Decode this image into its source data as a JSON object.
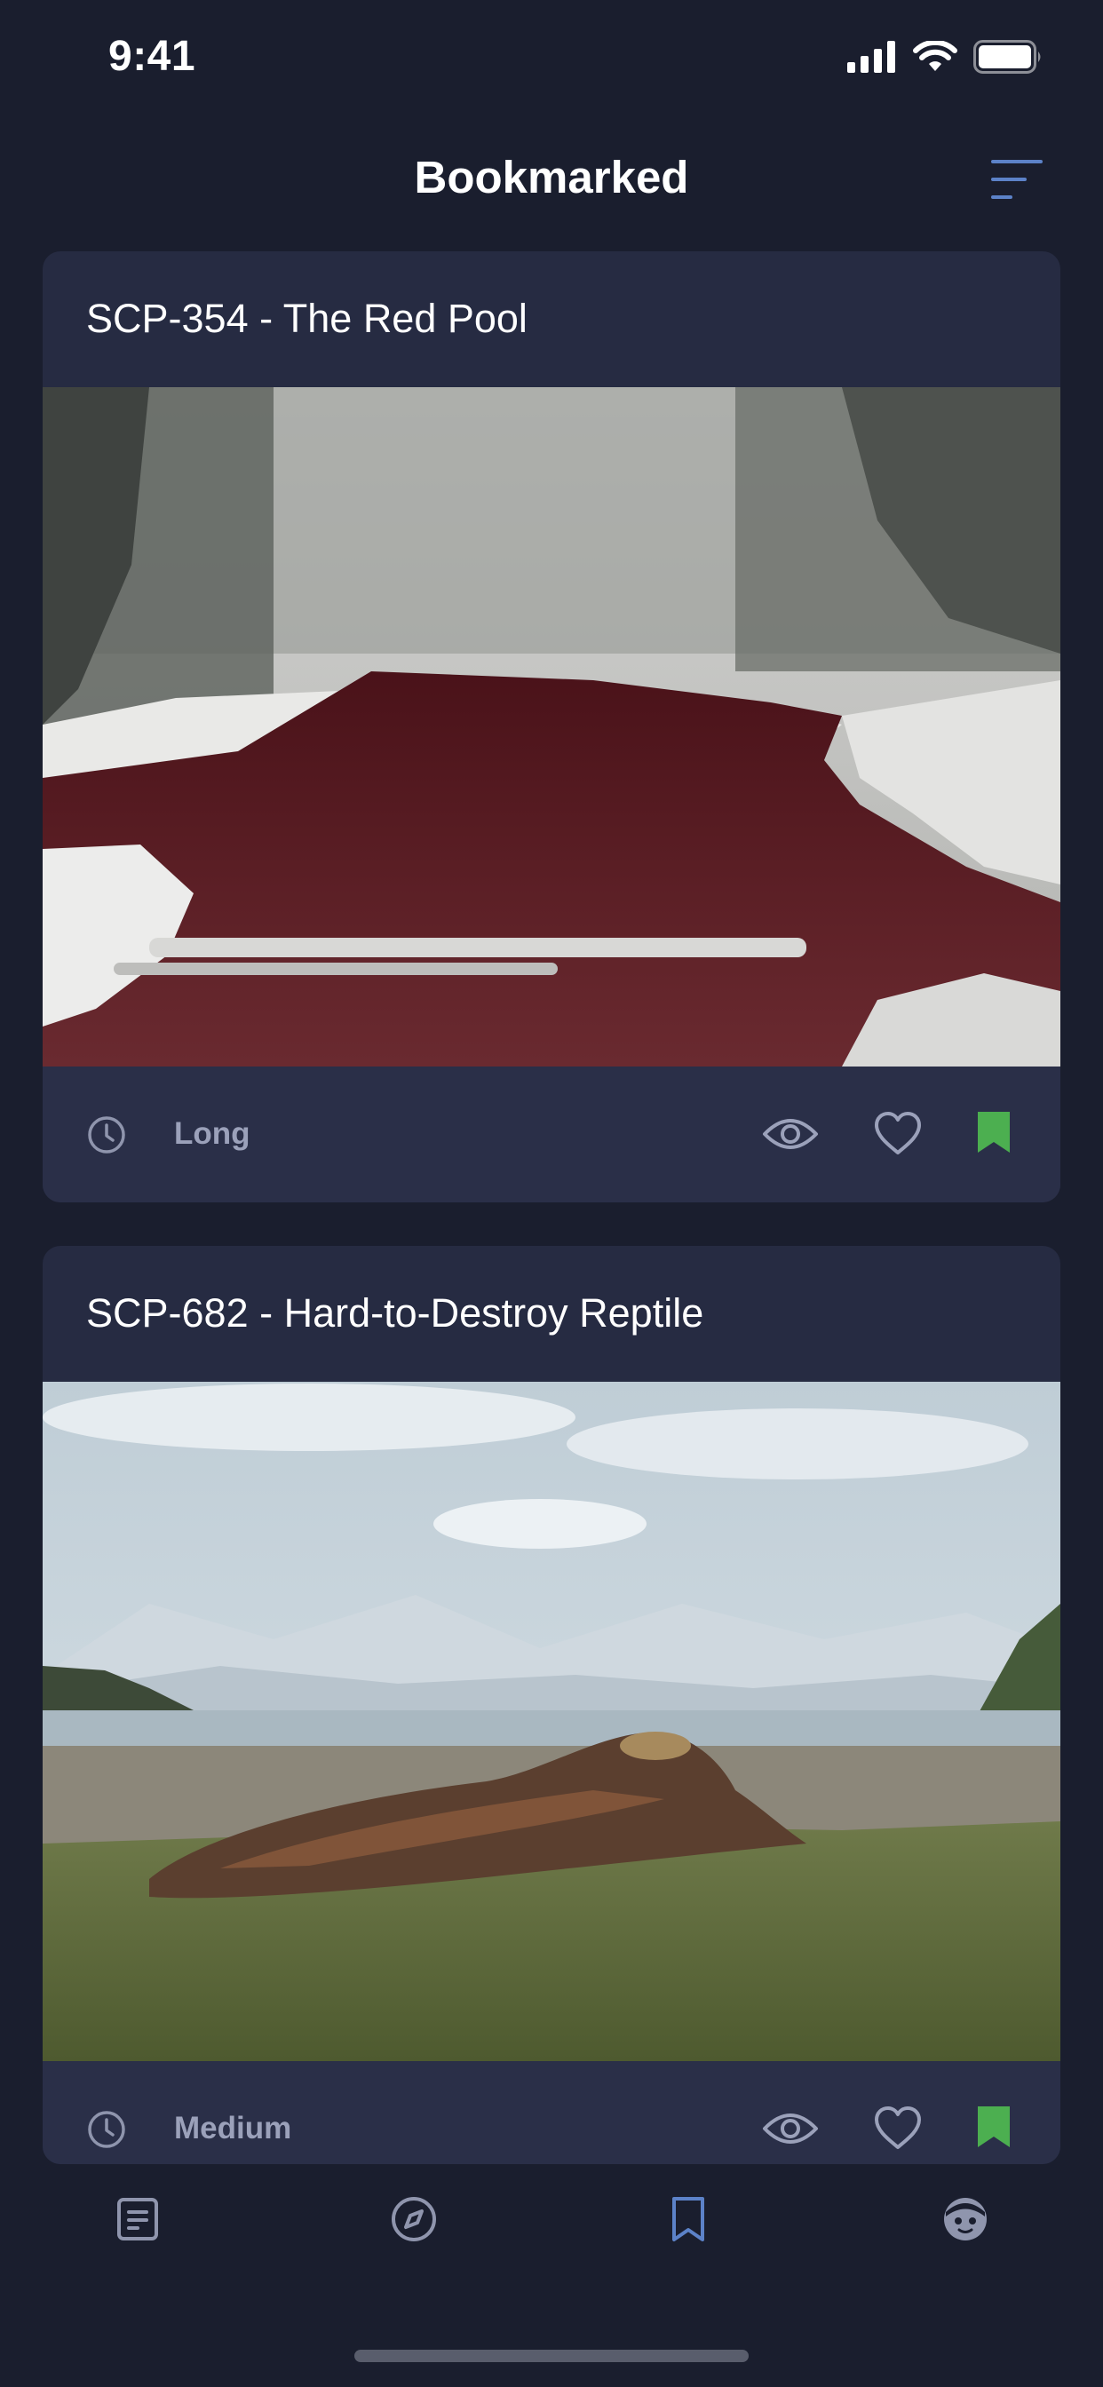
{
  "status_bar": {
    "time": "9:41"
  },
  "header": {
    "title": "Bookmarked",
    "sort_icon": "sort-lines-icon"
  },
  "colors": {
    "background": "#1a1e2e",
    "card": "#262b42",
    "accent_blue": "#5c82c8",
    "bookmarked_green": "#4caf50",
    "muted": "#9ba1ba"
  },
  "cards": [
    {
      "title": "SCP-354 - The Red Pool",
      "image_alt": "Red river flowing through a snowy forest",
      "length": "Long",
      "viewed": true,
      "liked": false,
      "bookmarked": true
    },
    {
      "title": "SCP-682 - Hard-to-Destroy Reptile",
      "image_alt": "Large reptile lying on grassy shore with mountains behind",
      "length": "Medium",
      "viewed": true,
      "liked": false,
      "bookmarked": true
    }
  ],
  "tabs": [
    {
      "name": "articles",
      "icon": "document-icon",
      "active": false
    },
    {
      "name": "explore",
      "icon": "compass-icon",
      "active": false
    },
    {
      "name": "bookmarks",
      "icon": "bookmark-icon",
      "active": true
    },
    {
      "name": "profile",
      "icon": "face-icon",
      "active": false
    }
  ]
}
